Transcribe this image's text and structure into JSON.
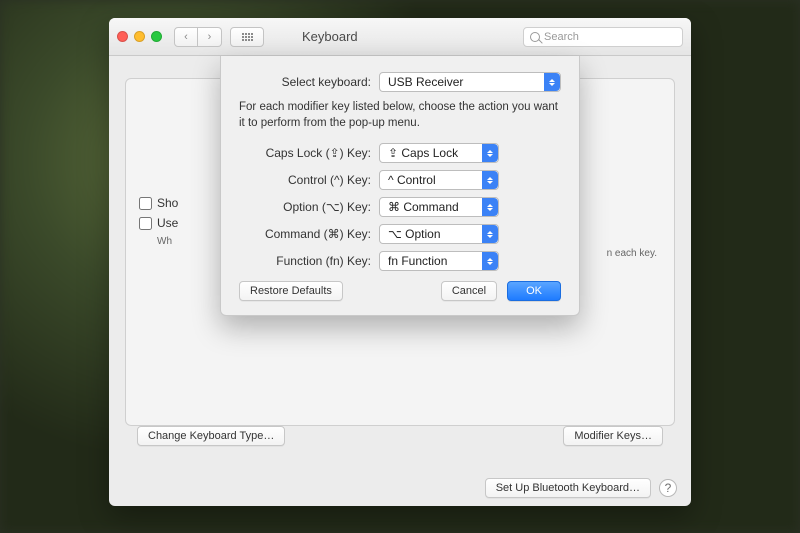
{
  "window": {
    "title": "Keyboard",
    "search_placeholder": "Search"
  },
  "background_panel": {
    "checkbox1": "Sho",
    "checkbox2": "Use",
    "hint_left": "Wh",
    "hint_right": "n each key.",
    "change_type": "Change Keyboard Type…",
    "modifier_keys": "Modifier Keys…"
  },
  "footer": {
    "bluetooth": "Set Up Bluetooth Keyboard…",
    "help": "?"
  },
  "sheet": {
    "select_label": "Select keyboard:",
    "select_value": "USB Receiver",
    "description": "For each modifier key listed below, choose the action you want it to perform from the pop-up menu.",
    "rows": {
      "caps": {
        "label": "Caps Lock (⇪) Key:",
        "value": "⇪ Caps Lock"
      },
      "control": {
        "label": "Control (^) Key:",
        "value": "^ Control"
      },
      "option": {
        "label": "Option (⌥) Key:",
        "value": "⌘ Command"
      },
      "command": {
        "label": "Command (⌘) Key:",
        "value": "⌥ Option"
      },
      "function": {
        "label": "Function (fn) Key:",
        "value": "fn Function"
      }
    },
    "restore": "Restore Defaults",
    "cancel": "Cancel",
    "ok": "OK"
  }
}
